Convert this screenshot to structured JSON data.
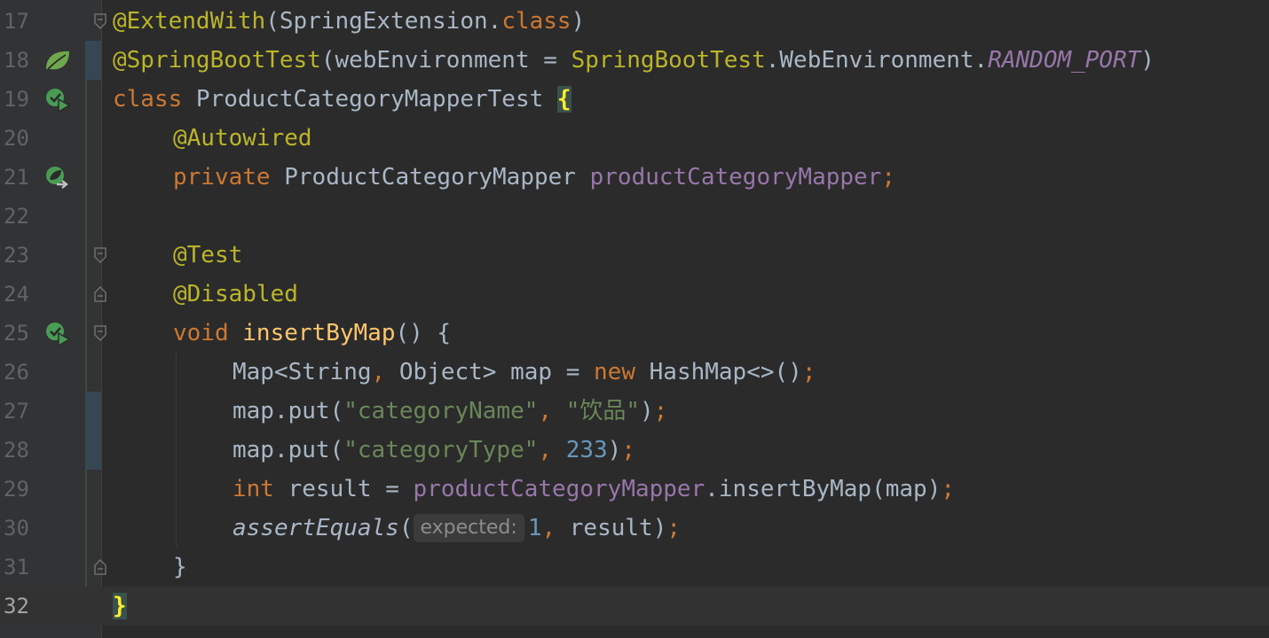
{
  "editor": {
    "current_line": 32,
    "lines": [
      {
        "number": "17"
      },
      {
        "number": "18",
        "icon": "spring-bean-icon"
      },
      {
        "number": "19",
        "icon": "run-test-icon"
      },
      {
        "number": "20"
      },
      {
        "number": "21",
        "icon": "navigate-to-bean-icon"
      },
      {
        "number": "22"
      },
      {
        "number": "23"
      },
      {
        "number": "24"
      },
      {
        "number": "25",
        "icon": "run-test-icon"
      },
      {
        "number": "26"
      },
      {
        "number": "27"
      },
      {
        "number": "28"
      },
      {
        "number": "29"
      },
      {
        "number": "30"
      },
      {
        "number": "31"
      },
      {
        "number": "32"
      }
    ],
    "code": {
      "l17": {
        "annotation": "@ExtendWith",
        "open": "(",
        "cls": "SpringExtension",
        "dot": ".",
        "kw": "class",
        "close": ")"
      },
      "l18": {
        "annotation": "@SpringBootTest",
        "open": "(",
        "param": "webEnvironment = ",
        "cls": "SpringBootTest",
        "dot1": ".",
        "inner": "WebEnvironment",
        "dot2": ".",
        "constant": "RANDOM_PORT",
        "close": ")"
      },
      "l19": {
        "kw": "class",
        "name": " ProductCategoryMapperTest ",
        "brace": "{"
      },
      "l20": {
        "annotation": "@Autowired"
      },
      "l21": {
        "kw": "private",
        "type": " ProductCategoryMapper ",
        "field": "productCategoryMapper",
        "semi": ";"
      },
      "l23": {
        "annotation": "@Test"
      },
      "l24": {
        "annotation": "@Disabled"
      },
      "l25": {
        "kw": "void",
        "sp": " ",
        "method": "insertByMap",
        "rest": "() {"
      },
      "l26": {
        "decl": "Map<String",
        "comma": ",",
        "decl2": " Object> map = ",
        "kw": "new",
        "rest": " HashMap<>()",
        "semi": ";"
      },
      "l27": {
        "call": "map.put(",
        "str1": "\"categoryName\"",
        "comma": ",",
        "sp": " ",
        "str2": "\"饮品\"",
        "close": ")",
        "semi": ";"
      },
      "l28": {
        "call": "map.put(",
        "str1": "\"categoryType\"",
        "comma": ",",
        "sp": " ",
        "num": "233",
        "close": ")",
        "semi": ";"
      },
      "l29": {
        "kw": "int",
        "mid": " result = ",
        "field": "productCategoryMapper",
        "rest": ".insertByMap(map)",
        "semi": ";"
      },
      "l30": {
        "static": "assertEquals",
        "open": "(",
        "hint": "expected:",
        "num": "1",
        "comma": ",",
        "rest": " result)",
        "semi": ";"
      },
      "l31": {
        "brace": "}"
      },
      "l32": {
        "brace": "}"
      }
    },
    "colors": {
      "background": "#2b2b2b",
      "gutter": "#313335",
      "annotation": "#bbb529",
      "keyword": "#cc7832",
      "string": "#6a8759",
      "number": "#6897bb",
      "field": "#9876aa",
      "method": "#ffc66d",
      "plain": "#a9b7c6"
    }
  }
}
